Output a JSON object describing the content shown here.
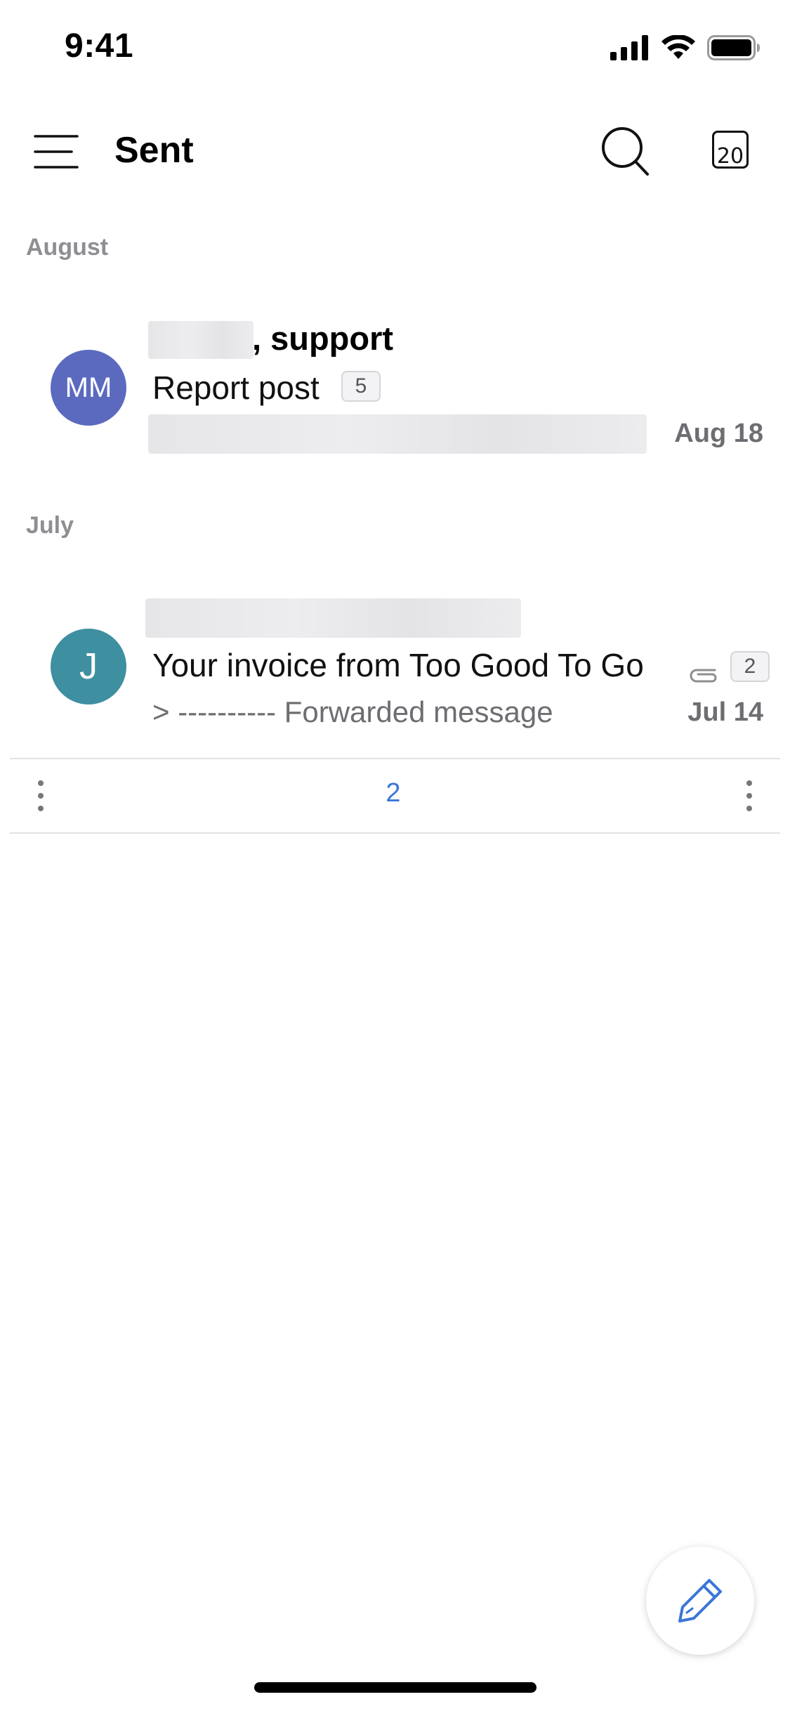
{
  "status_bar": {
    "time": "9:41",
    "icons": [
      "cellular-signal-icon",
      "wifi-icon",
      "battery-icon"
    ]
  },
  "header": {
    "title": "Sent",
    "calendar_day": "20",
    "icons": [
      "menu-icon",
      "search-icon",
      "calendar-icon"
    ]
  },
  "sections": [
    {
      "label": "August",
      "messages": [
        {
          "avatar_initials": "MM",
          "avatar_color": "#5b6abf",
          "sender_suffix": ", support",
          "subject": "Report post",
          "thread_count": "5",
          "date": "Aug 18"
        }
      ]
    },
    {
      "label": "July",
      "messages": [
        {
          "avatar_initials": "J",
          "avatar_color": "#3e8fa0",
          "subject": "Your invoice from Too Good To Go",
          "has_attachment": true,
          "thread_count": "2",
          "preview": "> ---------- Forwarded message",
          "date": "Jul 14"
        }
      ]
    }
  ],
  "pagination": {
    "page": "2"
  },
  "compose": {
    "icon": "compose-pen-icon",
    "accent_color": "#3a76d8"
  }
}
